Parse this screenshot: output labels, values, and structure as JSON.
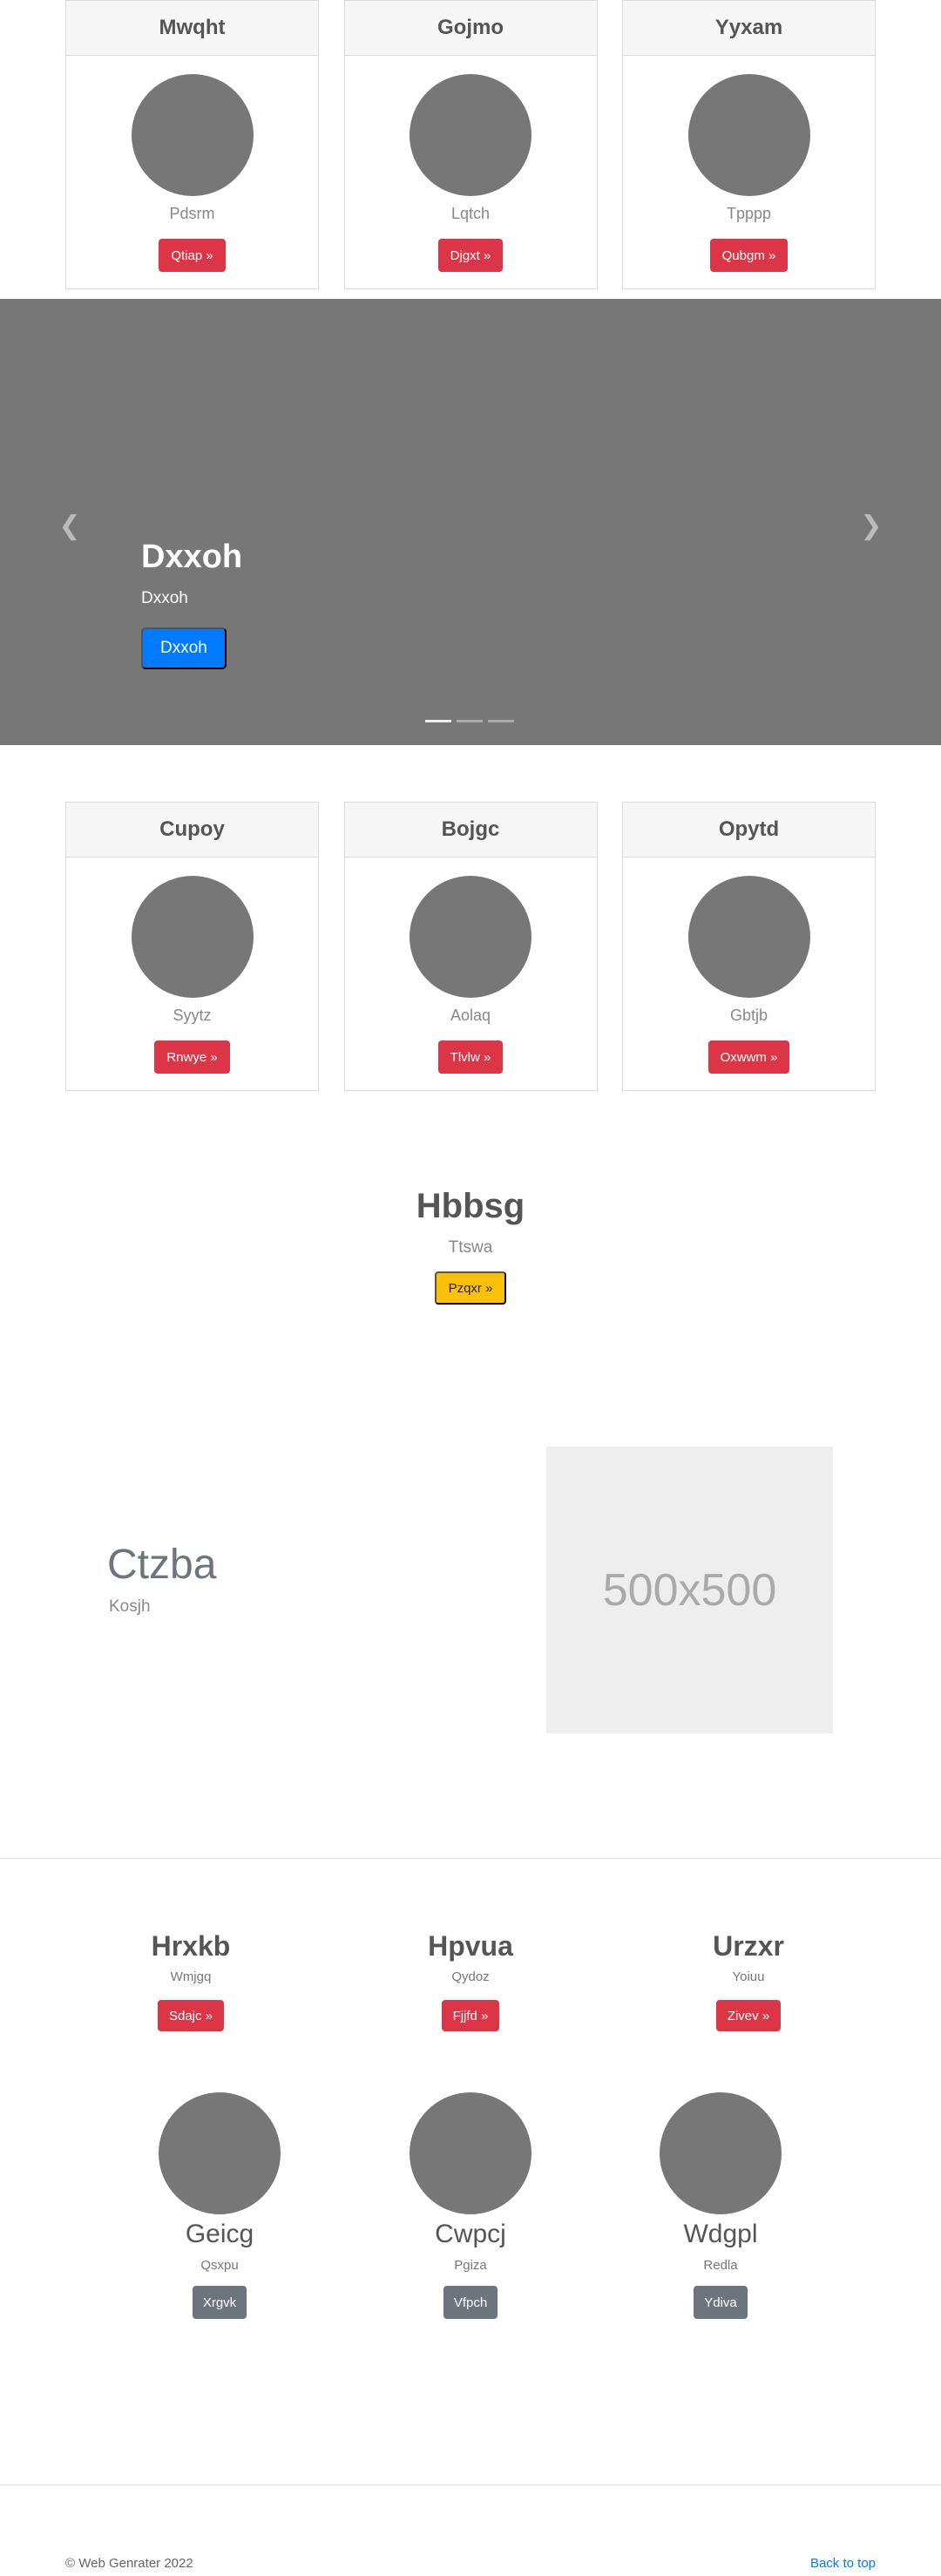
{
  "cards_top": [
    {
      "title": "Mwqht",
      "text": "Pdsrm",
      "button": "Qtiap »"
    },
    {
      "title": "Gojmo",
      "text": "Lqtch",
      "button": "Djgxt »"
    },
    {
      "title": "Yyxam",
      "text": "Tpppp",
      "button": "Qubgm »"
    }
  ],
  "carousel": {
    "title": "Dxxoh",
    "subtitle": "Dxxoh",
    "button": "Dxxoh",
    "prev_icon": "chevron-left-icon",
    "next_icon": "chevron-right-icon",
    "slides": 3,
    "active_slide": 1
  },
  "cards_mid": [
    {
      "title": "Cupoy",
      "text": "Syytz",
      "button": "Rnwye »"
    },
    {
      "title": "Bojgc",
      "text": "Aolaq",
      "button": "Tlvlw »"
    },
    {
      "title": "Opytd",
      "text": "Gbtjb",
      "button": "Oxwwm »"
    }
  ],
  "hero": {
    "title": "Hbbsg",
    "subtitle": "Ttswa",
    "button": "Pzqxr »"
  },
  "feature": {
    "title": "Ctzba",
    "subtitle": "Kosjh",
    "image_label": "500x500"
  },
  "columns": [
    {
      "title": "Hrxkb",
      "subtitle": "Wmjgq",
      "button": "Sdajc »"
    },
    {
      "title": "Hpvua",
      "subtitle": "Qydoz",
      "button": "Fjjfd »"
    },
    {
      "title": "Urzxr",
      "subtitle": "Yoiuu",
      "button": "Zivev »"
    }
  ],
  "people": [
    {
      "name": "Geicg",
      "subtitle": "Qsxpu",
      "button": "Xrgvk"
    },
    {
      "name": "Cwpcj",
      "subtitle": "Pgiza",
      "button": "Vfpch"
    },
    {
      "name": "Wdgpl",
      "subtitle": "Redla",
      "button": "Ydiva"
    }
  ],
  "footer": {
    "copyright": "© Web Genrater 2022",
    "back_to_top": "Back to top"
  },
  "colors": {
    "danger": "#dc3545",
    "primary": "#007bff",
    "warning": "#ffc107",
    "secondary": "#6c757d",
    "placeholder_grey": "#777777"
  }
}
